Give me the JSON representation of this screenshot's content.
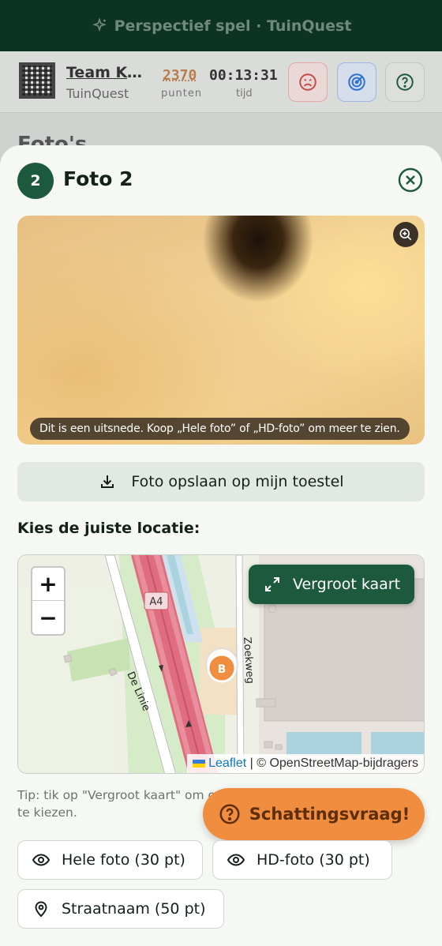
{
  "appbar": {
    "title": "Perspectief spel · TuinQuest",
    "icon": "sparkle-icon"
  },
  "team": {
    "name": "Team Ko...",
    "subtitle": "TuinQuest",
    "score": "2370",
    "score_label": "punten",
    "time": "00:13:31",
    "time_label": "tijd"
  },
  "page_title_behind": "Foto's",
  "sheet": {
    "badge": "2",
    "title": "Foto 2",
    "photo_note": "Dit is een uitsnede. Koop „Hele foto” of „HD-foto” om meer te zien.",
    "save_label": "Foto opslaan op mijn toestel",
    "choose_label": "Kies de juiste locatie:",
    "map": {
      "zoom_in": "+",
      "zoom_out": "−",
      "enlarge_label": "Vergroot kaart",
      "road_a4": "A4",
      "street_1": "De Linie",
      "street_2": "Zoekweg",
      "marker": "B",
      "attrib_leaflet": "Leaflet",
      "attrib_rest": " | © OpenStreetMap-bijdragers"
    },
    "tip": "Tip: tik op \"Vergroot kaart\" om op volledig scherm de juiste plek te kiezen.",
    "guess_label": "Schattingsvraag!",
    "buy_full": "Hele foto (30 pt)",
    "buy_hd": "HD-foto (30 pt)",
    "buy_street": "Straatnaam (50 pt)"
  },
  "colors": {
    "primary": "#1d5a3d",
    "accent": "#f08d3e",
    "danger": "#d9534f",
    "info": "#2a6fd6"
  }
}
